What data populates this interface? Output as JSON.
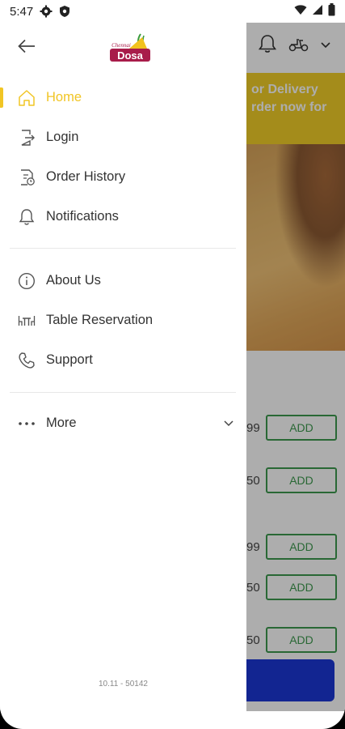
{
  "status_bar": {
    "time": "5:47"
  },
  "background": {
    "banner_line1": "or Delivery",
    "banner_line2": "rder now for",
    "items": [
      {
        "price": "99",
        "add_label": "ADD"
      },
      {
        "price": "50",
        "add_label": "ADD"
      },
      {
        "price": "99",
        "add_label": "ADD"
      },
      {
        "price": "50",
        "add_label": "ADD"
      },
      {
        "price": "50",
        "add_label": "ADD"
      }
    ]
  },
  "drawer": {
    "logo_top": "Chennai",
    "logo_text": "Dosa",
    "menu": [
      {
        "label": "Home",
        "icon": "home-icon",
        "active": true
      },
      {
        "label": "Login",
        "icon": "login-icon"
      },
      {
        "label": "Order History",
        "icon": "order-history-icon"
      },
      {
        "label": "Notifications",
        "icon": "bell-icon"
      },
      {
        "label": "About Us",
        "icon": "info-icon"
      },
      {
        "label": "Table Reservation",
        "icon": "table-icon"
      },
      {
        "label": "Support",
        "icon": "phone-icon"
      },
      {
        "label": "More",
        "icon": "more-dots-icon"
      }
    ],
    "version": "10.11 - 50142"
  },
  "colors": {
    "accent": "#f1c524",
    "add_green": "#3d9a4e",
    "cart_blue": "#1b37d6"
  }
}
